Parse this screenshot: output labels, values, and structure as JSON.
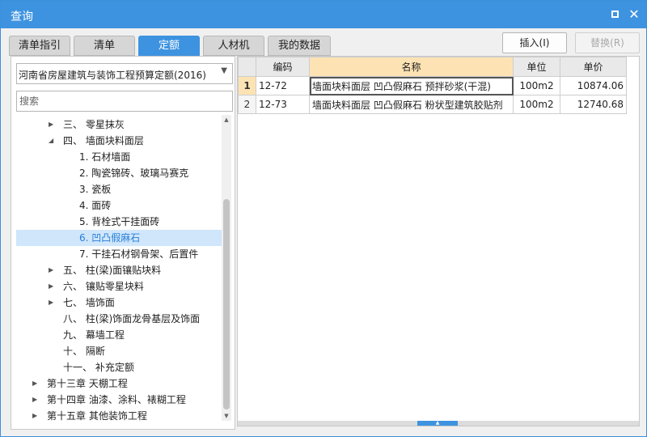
{
  "window": {
    "title": "查询",
    "maximize_icon": "maximize-icon",
    "close_label": "✕"
  },
  "tabs": [
    {
      "label": "清单指引"
    },
    {
      "label": "清单"
    },
    {
      "label": "定额"
    },
    {
      "label": "人材机"
    },
    {
      "label": "我的数据"
    }
  ],
  "active_tab": "定额",
  "toolbar": {
    "insert_label": "插入(I)",
    "replace_label": "替换(R)"
  },
  "library": {
    "selected": "河南省房屋建筑与装饰工程预算定额(2016)"
  },
  "search": {
    "placeholder": "搜索"
  },
  "tree": [
    {
      "label": "三、 零星抹灰",
      "expandable": true,
      "expanded": false
    },
    {
      "label": "四、 墙面块料面层",
      "expandable": true,
      "expanded": true
    },
    {
      "label": "1. 石材墙面"
    },
    {
      "label": "2. 陶瓷锦砖、玻璃马赛克"
    },
    {
      "label": "3. 瓷板"
    },
    {
      "label": "4. 面砖"
    },
    {
      "label": "5. 背栓式干挂面砖"
    },
    {
      "label": "6. 凹凸假麻石",
      "selected": true
    },
    {
      "label": "7. 干挂石材钢骨架、后置件"
    },
    {
      "label": "五、 柱(梁)面镶贴块料",
      "expandable": true,
      "expanded": false
    },
    {
      "label": "六、 镶贴零星块料",
      "expandable": true,
      "expanded": false
    },
    {
      "label": "七、 墙饰面",
      "expandable": true,
      "expanded": false
    },
    {
      "label": "八、 柱(梁)饰面龙骨基层及饰面"
    },
    {
      "label": "九、 幕墙工程"
    },
    {
      "label": "十、 隔断"
    },
    {
      "label": "十一、 补充定额"
    },
    {
      "label": "第十三章 天棚工程",
      "expandable": true,
      "expanded": false
    },
    {
      "label": "第十四章 油漆、涂料、裱糊工程",
      "expandable": true,
      "expanded": false
    },
    {
      "label": "第十五章 其他装饰工程",
      "expandable": true,
      "expanded": false
    }
  ],
  "grid": {
    "columns": [
      "编码",
      "名称",
      "单位",
      "单价"
    ],
    "rows": [
      {
        "num": "1",
        "code": "12-72",
        "name": "墙面块料面层 凹凸假麻石 预拌砂浆(干混)",
        "unit": "100m2",
        "price": "10874.06"
      },
      {
        "num": "2",
        "code": "12-73",
        "name": "墙面块料面层 凹凸假麻石 粉状型建筑胶贴剂",
        "unit": "100m2",
        "price": "12740.68"
      }
    ]
  }
}
